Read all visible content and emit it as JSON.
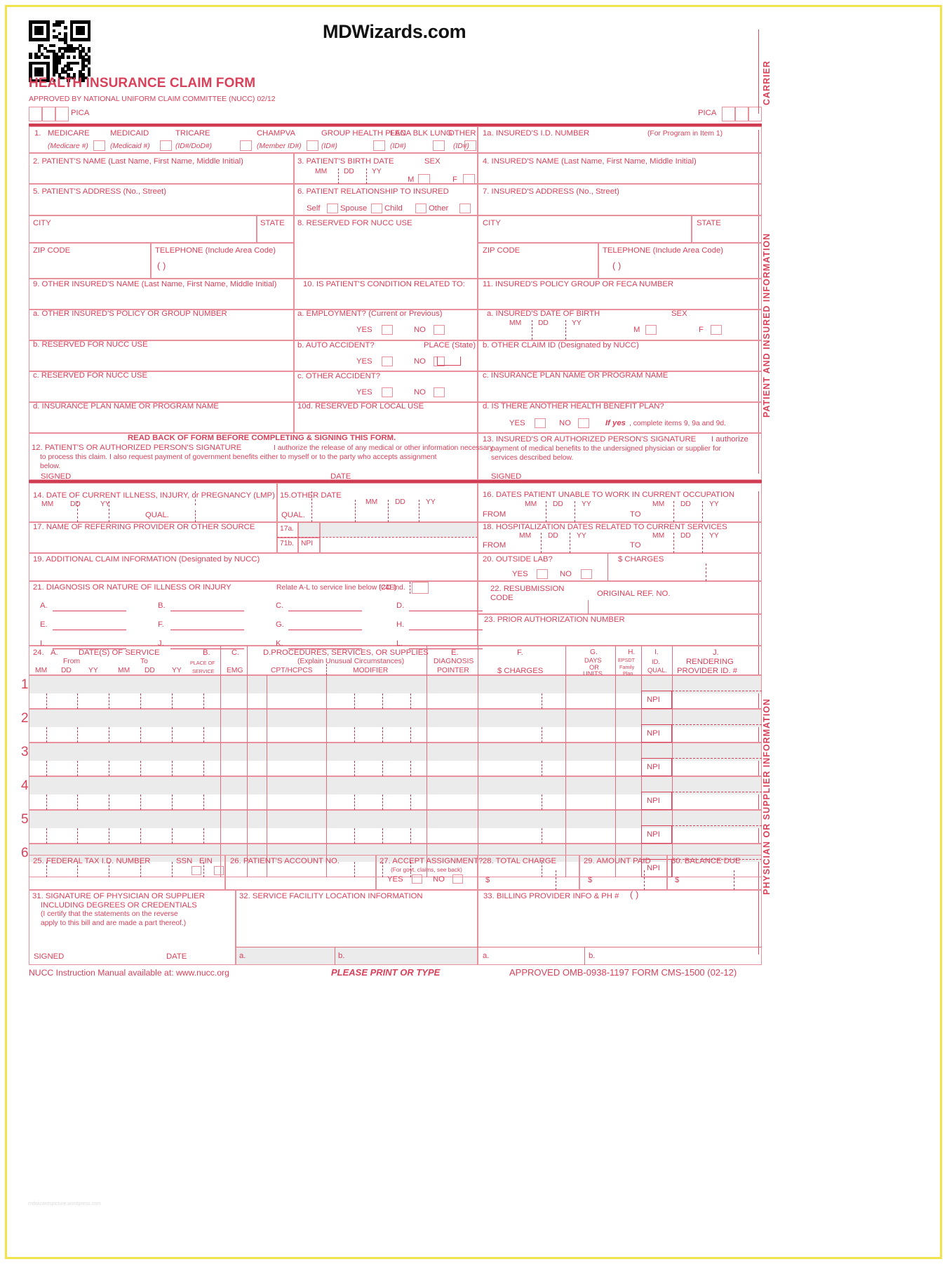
{
  "document": {
    "brand": "MDWizards.com",
    "title": "HEALTH INSURANCE CLAIM FORM",
    "subtitle": "APPROVED BY NATIONAL UNIFORM CLAIM COMMITTEE (NUCC) 02/12",
    "pica_left": "PICA",
    "pica_right": "PICA",
    "watermark": "mdwizardspicture.wordpress.com"
  },
  "side_labels": {
    "carrier": "CARRIER",
    "patient_insured": "PATIENT AND INSURED INFORMATION",
    "physician_supplier": "PHYSICIAN OR SUPPLIER INFORMATION"
  },
  "item1": {
    "number": "1.",
    "options": [
      {
        "name": "MEDICARE",
        "sub": "(Medicare #)"
      },
      {
        "name": "MEDICAID",
        "sub": "(Medicaid  #)"
      },
      {
        "name": "TRICARE",
        "sub": "(ID#/DoD#)"
      },
      {
        "name": "CHAMPVA",
        "sub": "(Member ID#)"
      },
      {
        "name": "GROUP\nHEALTH PLAN",
        "sub": "(ID#)"
      },
      {
        "name": "FECA\nBLK LUNG",
        "sub": "(ID#)"
      },
      {
        "name": "OTHER",
        "sub": "(ID#)"
      }
    ]
  },
  "item1a": {
    "label": "1a. INSURED'S I.D. NUMBER",
    "hint": "(For Program in Item 1)"
  },
  "item2": {
    "label": "2. PATIENT'S NAME (Last Name, First Name, Middle Initial)"
  },
  "item3": {
    "label": "3. PATIENT'S BIRTH DATE",
    "mm": "MM",
    "dd": "DD",
    "yy": "YY",
    "sex": "SEX",
    "m": "M",
    "f": "F"
  },
  "item4": {
    "label": "4. INSURED'S NAME (Last Name, First Name, Middle Initial)"
  },
  "item5": {
    "label": "5. PATIENT'S ADDRESS (No., Street)",
    "city": "CITY",
    "state": "STATE",
    "zip": "ZIP CODE",
    "telephone": "TELEPHONE (Include Area Code)",
    "paren": "(          )"
  },
  "item6": {
    "label": "6. PATIENT RELATIONSHIP TO INSURED",
    "options": [
      "Self",
      "Spouse",
      "Child",
      "Other"
    ]
  },
  "item7": {
    "label": "7. INSURED'S ADDRESS (No., Street)",
    "city": "CITY",
    "state": "STATE",
    "zip": "ZIP CODE",
    "telephone": "TELEPHONE (Include Area Code)",
    "paren": "(          )"
  },
  "item8": {
    "label": "8. RESERVED FOR NUCC USE"
  },
  "item9": {
    "label": "9. OTHER INSURED'S NAME (Last Name, First Name, Middle Initial)",
    "a": "a. OTHER INSURED'S POLICY OR GROUP NUMBER",
    "b": "b. RESERVED FOR NUCC USE",
    "c": "c. RESERVED FOR NUCC USE",
    "d": "d. INSURANCE PLAN NAME OR PROGRAM NAME"
  },
  "item10": {
    "label": "10. IS PATIENT'S CONDITION RELATED TO:",
    "a": "a. EMPLOYMENT? (Current or Previous)",
    "b": "b. AUTO ACCIDENT?",
    "b_place": "PLACE (State)",
    "c": "c. OTHER ACCIDENT?",
    "d": "10d. RESERVED FOR LOCAL USE",
    "yes": "YES",
    "no": "NO"
  },
  "item11": {
    "label": "11. INSURED'S POLICY GROUP OR FECA NUMBER",
    "a": "a. INSURED'S DATE OF BIRTH",
    "a_mm": "MM",
    "a_dd": "DD",
    "a_yy": "YY",
    "a_sex": "SEX",
    "a_m": "M",
    "a_f": "F",
    "b": "b. OTHER CLAIM ID (Designated by NUCC)",
    "c": "c. INSURANCE PLAN NAME OR PROGRAM NAME",
    "d": "d. IS THERE ANOTHER HEALTH BENEFIT PLAN?",
    "yes": "YES",
    "no": "NO",
    "ifyes_bold": "If yes",
    "ifyes_rest": ", complete items 9, 9a and 9d."
  },
  "item12": {
    "readback": "READ BACK OF FORM BEFORE COMPLETING & SIGNING THIS FORM.",
    "label": "12. PATIENT'S OR AUTHORIZED PERSON'S SIGNATURE",
    "line1": "I authorize the release of any medical or other information necessary",
    "line2": "to process this claim. I also request payment of government benefits either to myself or to the party who accepts assignment",
    "line3": "below.",
    "signed": "SIGNED",
    "date": "DATE"
  },
  "item13": {
    "label": "13. INSURED'S OR AUTHORIZED PERSON'S SIGNATURE",
    "line1": "I authorize",
    "line2": "payment of medical benefits to the undersigned physician or supplier for",
    "line3": "services described below.",
    "signed": "SIGNED"
  },
  "item14": {
    "label": "14. DATE OF CURRENT ILLNESS, INJURY, or PREGNANCY (LMP)",
    "mm": "MM",
    "dd": "DD",
    "yy": "YY",
    "qual": "QUAL."
  },
  "item15": {
    "label": "15.OTHER DATE",
    "qual": "QUAL.",
    "mm": "MM",
    "dd": "DD",
    "yy": "YY"
  },
  "item16": {
    "label": "16. DATES PATIENT UNABLE TO WORK IN CURRENT OCCUPATION",
    "mm": "MM",
    "dd": "DD",
    "yy": "YY",
    "from": "FROM",
    "to": "TO"
  },
  "item17": {
    "label": "17. NAME OF REFERRING PROVIDER OR OTHER SOURCE",
    "a": "17a.",
    "b": "71b.",
    "npi": "NPI"
  },
  "item18": {
    "label": "18. HOSPITALIZATION DATES RELATED TO CURRENT SERVICES",
    "mm": "MM",
    "dd": "DD",
    "yy": "YY",
    "from": "FROM",
    "to": "TO"
  },
  "item19": {
    "label": "19. ADDITIONAL CLAIM INFORMATION (Designated by NUCC)"
  },
  "item20": {
    "label": "20. OUTSIDE LAB?",
    "charges": "$ CHARGES",
    "yes": "YES",
    "no": "NO"
  },
  "item21": {
    "label": "21. DIAGNOSIS OR NATURE OF ILLNESS OR INJURY",
    "relate": "Relate A-L to service line below (24E)",
    "icd": "ICD Ind.",
    "letters": [
      "A.",
      "B.",
      "C.",
      "D.",
      "E.",
      "F.",
      "G.",
      "H.",
      "I.",
      "J.",
      "K.",
      "L."
    ]
  },
  "item22": {
    "label_l1": "22. RESUBMISSION",
    "label_l2": "CODE",
    "original": "ORIGINAL REF. NO."
  },
  "item23": {
    "label": "23. PRIOR AUTHORIZATION NUMBER"
  },
  "item24": {
    "num": "24.",
    "a_letter": "A.",
    "a_title": "DATE(S) OF SERVICE",
    "a_from": "From",
    "a_to": "To",
    "a_cols": [
      "MM",
      "DD",
      "YY",
      "MM",
      "DD",
      "YY"
    ],
    "b_letter": "B.",
    "b_l1": "PLACE OF",
    "b_l2": "SERVICE",
    "c_letter": "C.",
    "c_label": "EMG",
    "d_title": "D.PROCEDURES, SERVICES, OR SUPPLIES",
    "d_sub": "(Explain Unusual Circumstances)",
    "d_cpt": "CPT/HCPCS",
    "d_mod": "MODIFIER",
    "e_letter": "E.",
    "e_l1": "DIAGNOSIS",
    "e_l2": "POINTER",
    "f_letter": "F.",
    "f_label": "$ CHARGES",
    "g_letter": "G.",
    "g_l1": "DAYS",
    "g_l2": "OR",
    "g_l3": "UNITS",
    "h_letter": "H.",
    "h_l1": "EPSDT",
    "h_l2": "Family",
    "h_l3": "Plan",
    "i_letter": "I.",
    "i_l1": "ID.",
    "i_l2": "QUAL.",
    "j_letter": "J.",
    "j_l1": "RENDERING",
    "j_l2": "PROVIDER ID. #",
    "rows": [
      "1",
      "2",
      "3",
      "4",
      "5",
      "6"
    ],
    "npi": "NPI"
  },
  "item25": {
    "label": "25. FEDERAL TAX I.D. NUMBER",
    "ssn": "SSN",
    "ein": "EIN"
  },
  "item26": {
    "label": "26. PATIENT'S ACCOUNT NO."
  },
  "item27": {
    "label": "27. ACCEPT ASSIGNMENT?",
    "sub": "(For govt. claims, see back)",
    "yes": "YES",
    "no": "NO"
  },
  "item28": {
    "label": "28. TOTAL CHARGE",
    "dollar": "$"
  },
  "item29": {
    "label": "29. AMOUNT PAID",
    "dollar": "$"
  },
  "item30": {
    "label": "30. BALANCE DUE",
    "dollar": "$"
  },
  "item31": {
    "l1": "31. SIGNATURE OF PHYSICIAN OR SUPPLIER",
    "l2": "INCLUDING DEGREES OR CREDENTIALS",
    "l3": "(I certify that the statements on the reverse",
    "l4": "apply to this bill and are made a part thereof.)",
    "signed": "SIGNED",
    "date": "DATE"
  },
  "item32": {
    "label": "32. SERVICE FACILITY LOCATION INFORMATION",
    "a": "a.",
    "b": "b."
  },
  "item33": {
    "label": "33. BILLING PROVIDER INFO & PH #",
    "paren": "(          )",
    "a": "a.",
    "b": "b."
  },
  "footer": {
    "left": "NUCC Instruction Manual available at: www.nucc.org",
    "center": "PLEASE PRINT OR TYPE",
    "right": "APPROVED OMB-0938-1197 FORM CMS-1500 (02-12)"
  }
}
